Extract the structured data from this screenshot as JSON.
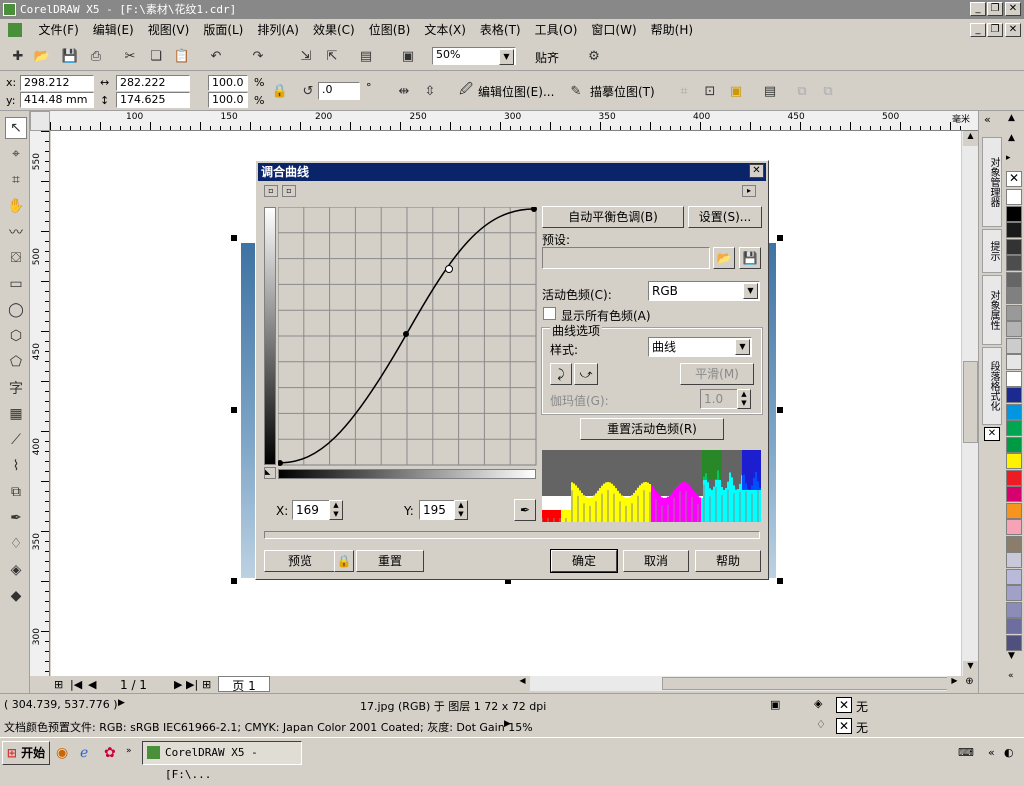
{
  "window": {
    "title": "CorelDRAW X5 - [F:\\素材\\花纹1.cdr]"
  },
  "menu": [
    "文件(F)",
    "编辑(E)",
    "视图(V)",
    "版面(L)",
    "排列(A)",
    "效果(C)",
    "位图(B)",
    "文本(X)",
    "表格(T)",
    "工具(O)",
    "窗口(W)",
    "帮助(H)"
  ],
  "toolbar": {
    "zoom": "50%",
    "snap": "贴齐"
  },
  "props": {
    "x": "298.212 mm",
    "y": "414.48 mm",
    "w": "282.222 mm",
    "h": "174.625 mm",
    "sx": "100.0",
    "sy": "100.0",
    "pct": "%",
    "rot": ".0",
    "deg": "°",
    "edit_bitmap": "编辑位图(E)...",
    "trace_bitmap": "描摹位图(T)"
  },
  "rulers": {
    "unit": "毫米",
    "h_ticks": [
      "100",
      "150",
      "200",
      "250",
      "300",
      "350",
      "400",
      "450",
      "500"
    ],
    "v_ticks": [
      "550",
      "500",
      "450",
      "400",
      "350",
      "300"
    ]
  },
  "dialog": {
    "title": "调合曲线",
    "auto_balance": "自动平衡色调(B)",
    "settings": "设置(S)...",
    "preset_label": "预设:",
    "channel_label": "活动色频(C):",
    "channel_value": "RGB",
    "show_all_label": "显示所有色频(A)",
    "curve_options": "曲线选项",
    "style_label": "样式:",
    "style_value": "曲线",
    "smooth": "平滑(M)",
    "gamma_label": "伽玛值(G):",
    "gamma_value": "1.0",
    "reset_channel": "重置活动色频(R)",
    "x_label": "X:",
    "x_value": "169",
    "y_label": "Y:",
    "y_value": "195",
    "preview": "预览",
    "reset": "重置",
    "ok": "确定",
    "cancel": "取消",
    "help": "帮助"
  },
  "pagebar": {
    "page_count": "1 / 1",
    "page_tab": "页 1"
  },
  "dock_tabs": [
    "对象管理器",
    "提示",
    "对象属性",
    "段落格式化"
  ],
  "status": {
    "coords": "( 304.739, 537.776 )",
    "object_info": "17.jpg (RGB) 于 图层 1 72 x 72 dpi",
    "profile": "文档颜色预置文件: RGB: sRGB IEC61966-2.1; CMYK: Japan Color 2001 Coated; 灰度: Dot Gain 15%",
    "fill_none": "无",
    "outline_none": "无"
  },
  "taskbar": {
    "start": "开始",
    "task": "CorelDRAW X5 - [F:\\..."
  },
  "palette_colors": [
    "#ffffff",
    "#000000",
    "#1a1a1a",
    "#333333",
    "#4d4d4d",
    "#666666",
    "#808080",
    "#999999",
    "#b3b3b3",
    "#cccccc",
    "#e6e6e6",
    "#ffffff",
    "#1b2a8f",
    "#0096e0",
    "#00a651",
    "#009a44",
    "#fff200",
    "#ed1c24",
    "#d6006f",
    "#f7941d",
    "#f5a3b5",
    "#8b7d6b",
    "#c8c8d8",
    "#b9b9d9",
    "#a0a0c8",
    "#8c8cb8",
    "#6d6d9f",
    "#50507e"
  ]
}
